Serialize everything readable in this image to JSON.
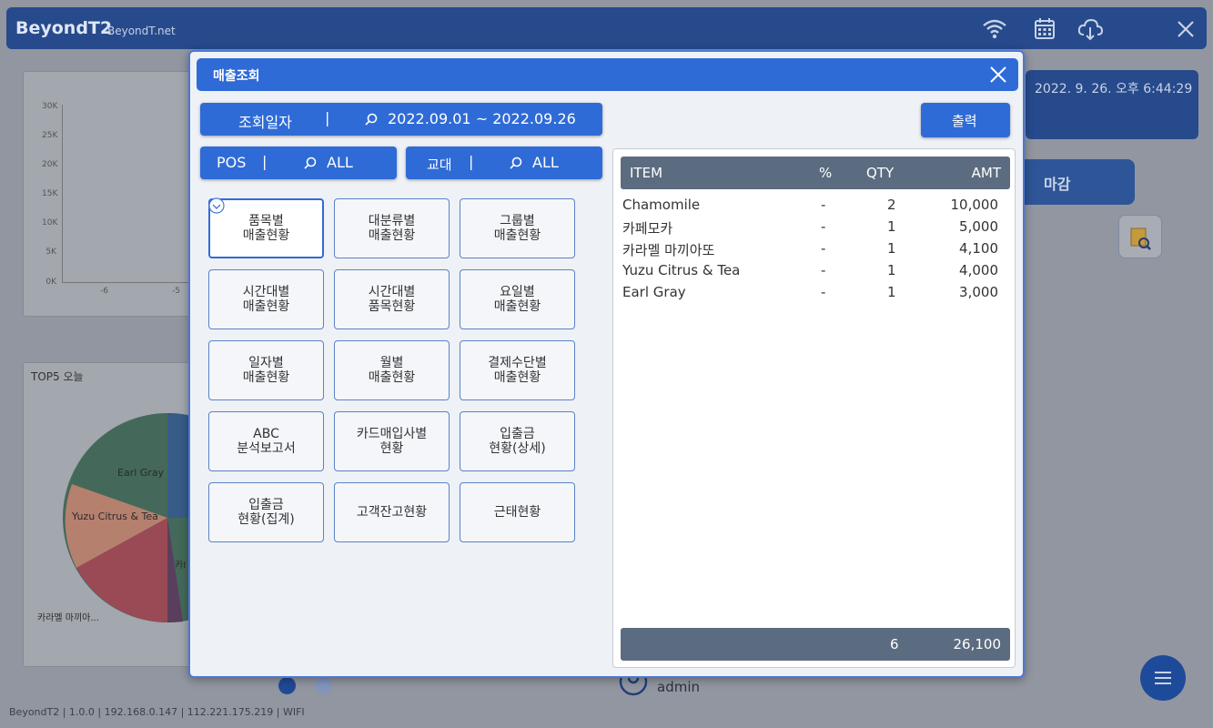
{
  "app": {
    "brand": "BeyondT2",
    "brand_sub": "BeyondT.net",
    "datetime": "2022. 9. 26. 오후 6:44:29",
    "close_label": "마감",
    "user_name": "admin",
    "footer": "BeyondT2  |  1.0.0  |  192.168.0.147  |  112.221.175.219  |  WIFI"
  },
  "icons": [
    "wifi-icon",
    "calendar-icon",
    "cloud-download-icon",
    "close-icon",
    "search-icon",
    "chevron-down-icon",
    "user-icon",
    "menu-icon",
    "document-search-icon"
  ],
  "bg_chart": {
    "y_ticks": [
      "30K",
      "25K",
      "20K",
      "15K",
      "10K",
      "5K",
      "0K"
    ],
    "x_ticks": [
      "-6",
      "-5"
    ]
  },
  "bg_pie": {
    "title": "TOP5 오늘",
    "labels": [
      "Earl Gray",
      "Yuzu Citrus & Tea",
      "카라멜 마끼아...",
      "카I"
    ]
  },
  "modal": {
    "title": "매출조회",
    "date_label": "조회일자",
    "date_sep": "|",
    "date_range": "2022.09.01  ~  2022.09.26",
    "print_label": "출력",
    "pos_label": "POS",
    "pos_value": "ALL",
    "shift_label": "교대",
    "shift_value": "ALL",
    "buttons": [
      "품목별\n매출현황",
      "대분류별\n매출현황",
      "그룹별\n매출현황",
      "시간대별\n매출현황",
      "시간대별\n품목현황",
      "요일별\n매출현황",
      "일자별\n매출현황",
      "월별\n매출현황",
      "결제수단별\n매출현황",
      "ABC\n분석보고서",
      "카드매입사별\n현황",
      "입출금\n현황(상세)",
      "입출금\n현황(집계)",
      "고객잔고현황",
      "근태현황"
    ]
  },
  "table": {
    "headers": {
      "item": "ITEM",
      "pct": "%",
      "qty": "QTY",
      "amt": "AMT"
    },
    "rows": [
      {
        "item": "Chamomile",
        "pct": "-",
        "qty": "2",
        "amt": "10,000"
      },
      {
        "item": "카페모카",
        "pct": "-",
        "qty": "1",
        "amt": "5,000"
      },
      {
        "item": "카라멜 마끼아또",
        "pct": "-",
        "qty": "1",
        "amt": "4,100"
      },
      {
        "item": "Yuzu Citrus & Tea",
        "pct": "-",
        "qty": "1",
        "amt": "4,000"
      },
      {
        "item": "Earl Gray",
        "pct": "-",
        "qty": "1",
        "amt": "3,000"
      }
    ],
    "total": {
      "qty": "6",
      "amt": "26,100"
    }
  },
  "colors": {
    "accent": "#2f6bd6",
    "header_dark": "#264a8c",
    "table_header": "#5c6c80"
  }
}
